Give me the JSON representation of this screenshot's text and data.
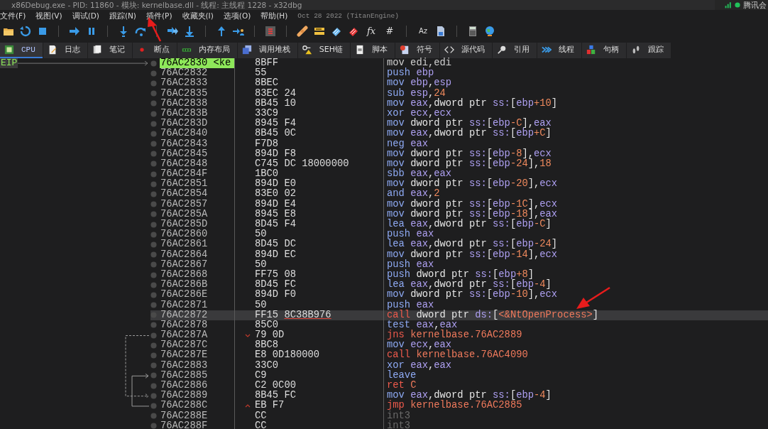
{
  "window": {
    "title": "x86Debug.exe - PID: 11860 - 模块: kernelbase.dll - 线程: 主线程 1228 - x32dbg"
  },
  "overlay_app": {
    "label": "腾讯会"
  },
  "menu": [
    "文件(F)",
    "视图(V)",
    "调试(D)",
    "跟踪(N)",
    "插件(P)",
    "收藏夹(I)",
    "选项(O)",
    "帮助(H)"
  ],
  "build_info": "Oct 28 2022 (TitanEngine)",
  "toolbar_text_buttons": [
    "fx",
    "#",
    "Aᴢ"
  ],
  "tabs": [
    {
      "label": "CPU",
      "selected": true
    },
    {
      "label": "日志",
      "selected": false
    },
    {
      "label": "笔记",
      "selected": false
    },
    {
      "label": "断点",
      "selected": false
    },
    {
      "label": "内存布局",
      "selected": false
    },
    {
      "label": "调用堆栈",
      "selected": false
    },
    {
      "label": "SEH链",
      "selected": false
    },
    {
      "label": "脚本",
      "selected": false
    },
    {
      "label": "符号",
      "selected": false
    },
    {
      "label": "源代码",
      "selected": false
    },
    {
      "label": "引用",
      "selected": false
    },
    {
      "label": "线程",
      "selected": false
    },
    {
      "label": "句柄",
      "selected": false
    },
    {
      "label": "跟踪",
      "selected": false
    }
  ],
  "eip_label": "EIP",
  "rows": [
    {
      "address": "76AC2830 <ke",
      "eip": true,
      "selected": false,
      "bytes": "8BFF",
      "instr": [
        {
          "kind": "dim",
          "text": "mov edi,edi"
        }
      ]
    },
    {
      "address": "76AC2832",
      "eip": false,
      "selected": false,
      "bytes": "55",
      "instr": [
        {
          "kind": "mn",
          "text": "push "
        },
        {
          "kind": "reg",
          "text": "ebp"
        }
      ]
    },
    {
      "address": "76AC2833",
      "eip": false,
      "selected": false,
      "bytes": "8BEC",
      "instr": [
        {
          "kind": "mn",
          "text": "mov "
        },
        {
          "kind": "reg",
          "text": "ebp"
        },
        {
          "kind": "txt",
          "text": ","
        },
        {
          "kind": "reg",
          "text": "esp"
        }
      ]
    },
    {
      "address": "76AC2835",
      "eip": false,
      "selected": false,
      "bytes": "83EC 24",
      "instr": [
        {
          "kind": "mn",
          "text": "sub "
        },
        {
          "kind": "reg",
          "text": "esp"
        },
        {
          "kind": "txt",
          "text": ","
        },
        {
          "kind": "num",
          "text": "24"
        }
      ]
    },
    {
      "address": "76AC2838",
      "eip": false,
      "selected": false,
      "bytes": "8B45 10",
      "instr": [
        {
          "kind": "mn",
          "text": "mov "
        },
        {
          "kind": "reg",
          "text": "eax"
        },
        {
          "kind": "txt",
          "text": ",dword ptr "
        },
        {
          "kind": "reg",
          "text": "ss:"
        },
        {
          "kind": "txt",
          "text": "["
        },
        {
          "kind": "reg",
          "text": "ebp"
        },
        {
          "kind": "num",
          "text": "+10"
        },
        {
          "kind": "txt",
          "text": "]"
        }
      ]
    },
    {
      "address": "76AC283B",
      "eip": false,
      "selected": false,
      "bytes": "33C9",
      "instr": [
        {
          "kind": "mn",
          "text": "xor "
        },
        {
          "kind": "reg",
          "text": "ecx"
        },
        {
          "kind": "txt",
          "text": ","
        },
        {
          "kind": "reg",
          "text": "ecx"
        }
      ]
    },
    {
      "address": "76AC283D",
      "eip": false,
      "selected": false,
      "bytes": "8945 F4",
      "instr": [
        {
          "kind": "mn",
          "text": "mov "
        },
        {
          "kind": "txt",
          "text": "dword ptr "
        },
        {
          "kind": "reg",
          "text": "ss:"
        },
        {
          "kind": "txt",
          "text": "["
        },
        {
          "kind": "reg",
          "text": "ebp"
        },
        {
          "kind": "num",
          "text": "-C"
        },
        {
          "kind": "txt",
          "text": "],"
        },
        {
          "kind": "reg",
          "text": "eax"
        }
      ]
    },
    {
      "address": "76AC2840",
      "eip": false,
      "selected": false,
      "bytes": "8B45 0C",
      "instr": [
        {
          "kind": "mn",
          "text": "mov "
        },
        {
          "kind": "reg",
          "text": "eax"
        },
        {
          "kind": "txt",
          "text": ",dword ptr "
        },
        {
          "kind": "reg",
          "text": "ss:"
        },
        {
          "kind": "txt",
          "text": "["
        },
        {
          "kind": "reg",
          "text": "ebp"
        },
        {
          "kind": "num",
          "text": "+C"
        },
        {
          "kind": "txt",
          "text": "]"
        }
      ]
    },
    {
      "address": "76AC2843",
      "eip": false,
      "selected": false,
      "bytes": "F7D8",
      "instr": [
        {
          "kind": "mn",
          "text": "neg "
        },
        {
          "kind": "reg",
          "text": "eax"
        }
      ]
    },
    {
      "address": "76AC2845",
      "eip": false,
      "selected": false,
      "bytes": "894D F8",
      "instr": [
        {
          "kind": "mn",
          "text": "mov "
        },
        {
          "kind": "txt",
          "text": "dword ptr "
        },
        {
          "kind": "reg",
          "text": "ss:"
        },
        {
          "kind": "txt",
          "text": "["
        },
        {
          "kind": "reg",
          "text": "ebp"
        },
        {
          "kind": "num",
          "text": "-8"
        },
        {
          "kind": "txt",
          "text": "],"
        },
        {
          "kind": "reg",
          "text": "ecx"
        }
      ]
    },
    {
      "address": "76AC2848",
      "eip": false,
      "selected": false,
      "bytes": "C745 DC 18000000",
      "instr": [
        {
          "kind": "mn",
          "text": "mov "
        },
        {
          "kind": "txt",
          "text": "dword ptr "
        },
        {
          "kind": "reg",
          "text": "ss:"
        },
        {
          "kind": "txt",
          "text": "["
        },
        {
          "kind": "reg",
          "text": "ebp"
        },
        {
          "kind": "num",
          "text": "-24"
        },
        {
          "kind": "txt",
          "text": "],"
        },
        {
          "kind": "num",
          "text": "18"
        }
      ]
    },
    {
      "address": "76AC284F",
      "eip": false,
      "selected": false,
      "bytes": "1BC0",
      "instr": [
        {
          "kind": "mn",
          "text": "sbb "
        },
        {
          "kind": "reg",
          "text": "eax"
        },
        {
          "kind": "txt",
          "text": ","
        },
        {
          "kind": "reg",
          "text": "eax"
        }
      ]
    },
    {
      "address": "76AC2851",
      "eip": false,
      "selected": false,
      "bytes": "894D E0",
      "instr": [
        {
          "kind": "mn",
          "text": "mov "
        },
        {
          "kind": "txt",
          "text": "dword ptr "
        },
        {
          "kind": "reg",
          "text": "ss:"
        },
        {
          "kind": "txt",
          "text": "["
        },
        {
          "kind": "reg",
          "text": "ebp"
        },
        {
          "kind": "num",
          "text": "-20"
        },
        {
          "kind": "txt",
          "text": "],"
        },
        {
          "kind": "reg",
          "text": "ecx"
        }
      ]
    },
    {
      "address": "76AC2854",
      "eip": false,
      "selected": false,
      "bytes": "83E0 02",
      "instr": [
        {
          "kind": "mn",
          "text": "and "
        },
        {
          "kind": "reg",
          "text": "eax"
        },
        {
          "kind": "txt",
          "text": ","
        },
        {
          "kind": "num",
          "text": "2"
        }
      ]
    },
    {
      "address": "76AC2857",
      "eip": false,
      "selected": false,
      "bytes": "894D E4",
      "instr": [
        {
          "kind": "mn",
          "text": "mov "
        },
        {
          "kind": "txt",
          "text": "dword ptr "
        },
        {
          "kind": "reg",
          "text": "ss:"
        },
        {
          "kind": "txt",
          "text": "["
        },
        {
          "kind": "reg",
          "text": "ebp"
        },
        {
          "kind": "num",
          "text": "-1C"
        },
        {
          "kind": "txt",
          "text": "],"
        },
        {
          "kind": "reg",
          "text": "ecx"
        }
      ]
    },
    {
      "address": "76AC285A",
      "eip": false,
      "selected": false,
      "bytes": "8945 E8",
      "instr": [
        {
          "kind": "mn",
          "text": "mov "
        },
        {
          "kind": "txt",
          "text": "dword ptr "
        },
        {
          "kind": "reg",
          "text": "ss:"
        },
        {
          "kind": "txt",
          "text": "["
        },
        {
          "kind": "reg",
          "text": "ebp"
        },
        {
          "kind": "num",
          "text": "-18"
        },
        {
          "kind": "txt",
          "text": "],"
        },
        {
          "kind": "reg",
          "text": "eax"
        }
      ]
    },
    {
      "address": "76AC285D",
      "eip": false,
      "selected": false,
      "bytes": "8D45 F4",
      "instr": [
        {
          "kind": "mn",
          "text": "lea "
        },
        {
          "kind": "reg",
          "text": "eax"
        },
        {
          "kind": "txt",
          "text": ",dword ptr "
        },
        {
          "kind": "reg",
          "text": "ss:"
        },
        {
          "kind": "txt",
          "text": "["
        },
        {
          "kind": "reg",
          "text": "ebp"
        },
        {
          "kind": "num",
          "text": "-C"
        },
        {
          "kind": "txt",
          "text": "]"
        }
      ]
    },
    {
      "address": "76AC2860",
      "eip": false,
      "selected": false,
      "bytes": "50",
      "instr": [
        {
          "kind": "mn",
          "text": "push "
        },
        {
          "kind": "reg",
          "text": "eax"
        }
      ]
    },
    {
      "address": "76AC2861",
      "eip": false,
      "selected": false,
      "bytes": "8D45 DC",
      "instr": [
        {
          "kind": "mn",
          "text": "lea "
        },
        {
          "kind": "reg",
          "text": "eax"
        },
        {
          "kind": "txt",
          "text": ",dword ptr "
        },
        {
          "kind": "reg",
          "text": "ss:"
        },
        {
          "kind": "txt",
          "text": "["
        },
        {
          "kind": "reg",
          "text": "ebp"
        },
        {
          "kind": "num",
          "text": "-24"
        },
        {
          "kind": "txt",
          "text": "]"
        }
      ]
    },
    {
      "address": "76AC2864",
      "eip": false,
      "selected": false,
      "bytes": "894D EC",
      "instr": [
        {
          "kind": "mn",
          "text": "mov "
        },
        {
          "kind": "txt",
          "text": "dword ptr "
        },
        {
          "kind": "reg",
          "text": "ss:"
        },
        {
          "kind": "txt",
          "text": "["
        },
        {
          "kind": "reg",
          "text": "ebp"
        },
        {
          "kind": "num",
          "text": "-14"
        },
        {
          "kind": "txt",
          "text": "],"
        },
        {
          "kind": "reg",
          "text": "ecx"
        }
      ]
    },
    {
      "address": "76AC2867",
      "eip": false,
      "selected": false,
      "bytes": "50",
      "instr": [
        {
          "kind": "mn",
          "text": "push "
        },
        {
          "kind": "reg",
          "text": "eax"
        }
      ]
    },
    {
      "address": "76AC2868",
      "eip": false,
      "selected": false,
      "bytes": "FF75 08",
      "instr": [
        {
          "kind": "mn",
          "text": "push "
        },
        {
          "kind": "txt",
          "text": "dword ptr "
        },
        {
          "kind": "reg",
          "text": "ss:"
        },
        {
          "kind": "txt",
          "text": "["
        },
        {
          "kind": "reg",
          "text": "ebp"
        },
        {
          "kind": "num",
          "text": "+8"
        },
        {
          "kind": "txt",
          "text": "]"
        }
      ]
    },
    {
      "address": "76AC286B",
      "eip": false,
      "selected": false,
      "bytes": "8D45 FC",
      "instr": [
        {
          "kind": "mn",
          "text": "lea "
        },
        {
          "kind": "reg",
          "text": "eax"
        },
        {
          "kind": "txt",
          "text": ",dword ptr "
        },
        {
          "kind": "reg",
          "text": "ss:"
        },
        {
          "kind": "txt",
          "text": "["
        },
        {
          "kind": "reg",
          "text": "ebp"
        },
        {
          "kind": "num",
          "text": "-4"
        },
        {
          "kind": "txt",
          "text": "]"
        }
      ]
    },
    {
      "address": "76AC286E",
      "eip": false,
      "selected": false,
      "bytes": "894D F0",
      "instr": [
        {
          "kind": "mn",
          "text": "mov "
        },
        {
          "kind": "txt",
          "text": "dword ptr "
        },
        {
          "kind": "reg",
          "text": "ss:"
        },
        {
          "kind": "txt",
          "text": "["
        },
        {
          "kind": "reg",
          "text": "ebp"
        },
        {
          "kind": "num",
          "text": "-10"
        },
        {
          "kind": "txt",
          "text": "],"
        },
        {
          "kind": "reg",
          "text": "ecx"
        }
      ]
    },
    {
      "address": "76AC2871",
      "eip": false,
      "selected": false,
      "bytes": "50",
      "instr": [
        {
          "kind": "mn",
          "text": "push "
        },
        {
          "kind": "reg",
          "text": "eax"
        }
      ]
    },
    {
      "address": "76AC2872",
      "eip": false,
      "selected": true,
      "bytes": "FF15",
      "bytes_ref": "8C38B976",
      "instr": [
        {
          "kind": "br",
          "text": "call "
        },
        {
          "kind": "txt",
          "text": "dword ptr "
        },
        {
          "kind": "reg",
          "text": "ds:"
        },
        {
          "kind": "txt",
          "text": "["
        },
        {
          "kind": "lbl",
          "text": "<&NtOpenProcess>"
        },
        {
          "kind": "txt",
          "text": "]"
        }
      ]
    },
    {
      "address": "76AC2878",
      "eip": false,
      "selected": false,
      "bytes": "85C0",
      "instr": [
        {
          "kind": "mn",
          "text": "test "
        },
        {
          "kind": "reg",
          "text": "eax"
        },
        {
          "kind": "txt",
          "text": ","
        },
        {
          "kind": "reg",
          "text": "eax"
        }
      ]
    },
    {
      "address": "76AC287A",
      "eip": false,
      "selected": false,
      "bytes": "79 0D",
      "branch": {
        "kind": "down",
        "taken": false
      },
      "instr": [
        {
          "kind": "br",
          "text": "jns "
        },
        {
          "kind": "lbl",
          "text": "kernelbase.76AC2889"
        }
      ]
    },
    {
      "address": "76AC287C",
      "eip": false,
      "selected": false,
      "bytes": "8BC8",
      "instr": [
        {
          "kind": "mn",
          "text": "mov "
        },
        {
          "kind": "reg",
          "text": "ecx"
        },
        {
          "kind": "txt",
          "text": ","
        },
        {
          "kind": "reg",
          "text": "eax"
        }
      ]
    },
    {
      "address": "76AC287E",
      "eip": false,
      "selected": false,
      "bytes": "E8 0D180000",
      "instr": [
        {
          "kind": "br",
          "text": "call "
        },
        {
          "kind": "lbl",
          "text": "kernelbase.76AC4090"
        }
      ]
    },
    {
      "address": "76AC2883",
      "eip": false,
      "selected": false,
      "bytes": "33C0",
      "instr": [
        {
          "kind": "mn",
          "text": "xor "
        },
        {
          "kind": "reg",
          "text": "eax"
        },
        {
          "kind": "txt",
          "text": ","
        },
        {
          "kind": "reg",
          "text": "eax"
        }
      ]
    },
    {
      "address": "76AC2885",
      "eip": false,
      "selected": false,
      "jump_target": {
        "kind": "up"
      },
      "bytes": "C9",
      "instr": [
        {
          "kind": "mn",
          "text": "leave"
        }
      ]
    },
    {
      "address": "76AC2886",
      "eip": false,
      "selected": false,
      "bytes": "C2 0C00",
      "instr": [
        {
          "kind": "br",
          "text": "ret "
        },
        {
          "kind": "lbl",
          "text": "C"
        }
      ]
    },
    {
      "address": "76AC2889",
      "eip": false,
      "selected": false,
      "jump_target": {
        "kind": "down"
      },
      "bytes": "8B45 FC",
      "instr": [
        {
          "kind": "mn",
          "text": "mov "
        },
        {
          "kind": "reg",
          "text": "eax"
        },
        {
          "kind": "txt",
          "text": ",dword ptr "
        },
        {
          "kind": "reg",
          "text": "ss:"
        },
        {
          "kind": "txt",
          "text": "["
        },
        {
          "kind": "reg",
          "text": "ebp"
        },
        {
          "kind": "num",
          "text": "-4"
        },
        {
          "kind": "txt",
          "text": "]"
        }
      ]
    },
    {
      "address": "76AC288C",
      "eip": false,
      "selected": false,
      "bytes": "EB F7",
      "branch": {
        "kind": "up",
        "taken": true
      },
      "instr": [
        {
          "kind": "br",
          "text": "jmp "
        },
        {
          "kind": "lbl",
          "text": "kernelbase.76AC2885"
        }
      ]
    },
    {
      "address": "76AC288E",
      "eip": false,
      "selected": false,
      "bytes": "CC",
      "instr": [
        {
          "kind": "pad",
          "text": "int3"
        }
      ]
    },
    {
      "address": "76AC288F",
      "eip": false,
      "selected": false,
      "bytes": "CC",
      "instr": [
        {
          "kind": "pad",
          "text": "int3"
        }
      ]
    }
  ]
}
